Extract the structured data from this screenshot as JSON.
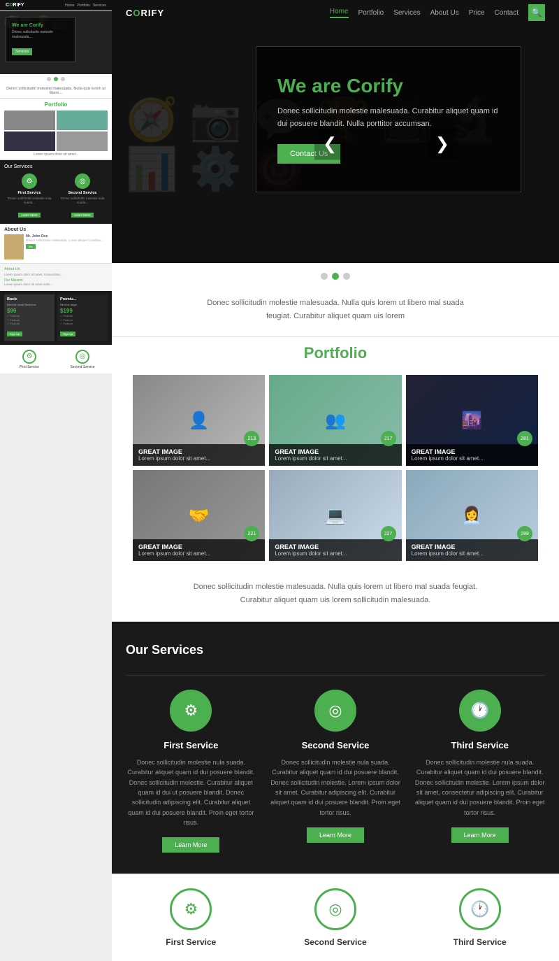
{
  "nav": {
    "logo": "C",
    "logo_text": "RIFY",
    "links": [
      "Home",
      "Portfolio",
      "Services",
      "About Us",
      "Price",
      "Contact"
    ],
    "active": "Home"
  },
  "hero": {
    "heading": "We are Corify",
    "body": "Donec sollicitudin molestie malesuada. Curabitur aliquet quam id dui posuere blandit. Nulla porttitor accumsan.",
    "cta": "Contact Us",
    "prev": "❮",
    "next": "❯"
  },
  "intro": "Donec sollicitudin molestie malesuada. Nulla quis lorem ut libero mal suada feugiat. Curabitur aliquet quam uis lorem",
  "portfolio": {
    "title": "Portfolio",
    "items": [
      {
        "title": "GREAT IMAGE",
        "desc": "Lorem ipsum dolor sit amet...",
        "badge": "213"
      },
      {
        "title": "GREAT IMAGE",
        "desc": "Lorem ipsum dolor sit amet...",
        "badge": "217"
      },
      {
        "title": "GREAT IMAGE",
        "desc": "Lorem ipsum dolor sit amet...",
        "badge": "281"
      },
      {
        "title": "GREAT IMAGE",
        "desc": "Lorem ipsum dolor sit amet...",
        "badge": "221"
      },
      {
        "title": "GREAT IMAGE",
        "desc": "Lorem ipsum dolor sit amet...",
        "badge": "227"
      },
      {
        "title": "GREAT IMAGE",
        "desc": "Lorem ipsum dolor sit amet...",
        "badge": "299"
      }
    ],
    "footer": "Donec sollicitudin molestie malesuada. Nulla quis lorem ut libero mal suada feugiat. Curabitur\naliquet quam uis lorem sollicitudin malesuada."
  },
  "services": {
    "title": "Our Services",
    "items": [
      {
        "name": "First Service",
        "icon": "⚙",
        "desc": "Donec sollicitudin molestie nula suada. Curabitur aliquet quam id dui posuere blandit. Donec sollicitudin molestie. Curabitur aliquet quam id dui ut posuere blandit. Donec sollicitudin adipiscing elit. Curabitur aliquet quam id dui posuere blandit. Proin eget tortor risus.",
        "btn": "Learn More"
      },
      {
        "name": "Second Service",
        "icon": "◎",
        "desc": "Donec sollicitudin molestie nula suada. Curabitur aliquet quam id dui posuere blandit. Donec sollicitudin molestie. Lorem ipsum dolor sit amet. Curabitur adipiscing elit. Curabitur aliquet quam id dui posuere blandit. Proin eget tortor risus.",
        "btn": "Learn More"
      },
      {
        "name": "Third Service",
        "icon": "🕐",
        "desc": "Donec sollicitudin molestie nula suada. Curabitur aliquet quam id dui posuere blandit. Donec sollicitudin molestie. Lorem ipsum dolor sit amet, consectetur adipiscing elit. Curabitur aliquet quam id dui posuere blandit. Proin eget tortor risus.",
        "btn": "Learn More"
      }
    ]
  },
  "services_row2": {
    "items": [
      {
        "name": "First Service",
        "icon": "⚙"
      },
      {
        "name": "Second Service",
        "icon": "◎"
      },
      {
        "name": "Third Service",
        "icon": "🕐"
      }
    ]
  }
}
